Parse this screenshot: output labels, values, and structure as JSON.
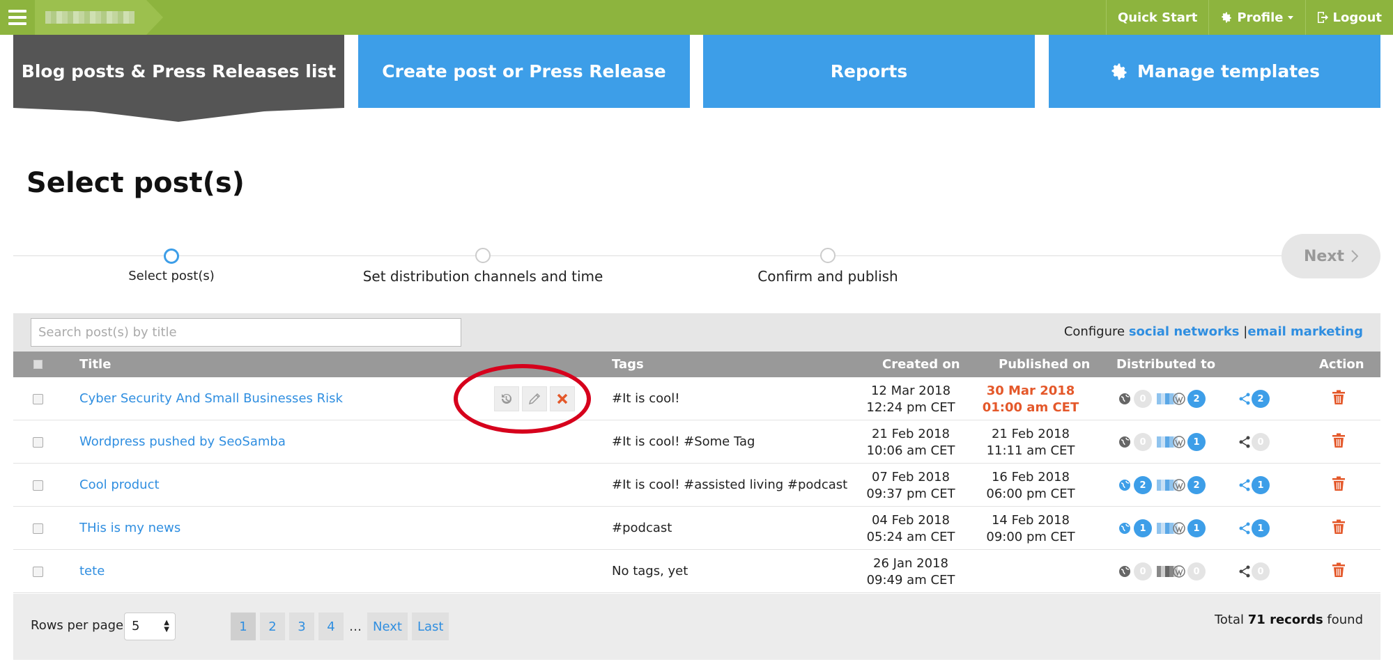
{
  "topbar": {
    "nav": {
      "quick_start": "Quick Start",
      "profile": "Profile",
      "logout": "Logout"
    }
  },
  "tabs": [
    {
      "label": "Blog posts & Press Releases list",
      "active": true
    },
    {
      "label": "Create post or Press Release",
      "active": false
    },
    {
      "label": "Reports",
      "active": false
    },
    {
      "label": "Manage templates",
      "active": false
    }
  ],
  "page_title": "Select post(s)",
  "stepper": {
    "steps": [
      "Select post(s)",
      "Set distribution channels and time",
      "Confirm and publish"
    ],
    "current": 0,
    "next_label": "Next"
  },
  "filter": {
    "search_placeholder": "Search post(s) by title",
    "configure_prefix": "Configure",
    "social_link": "social networks",
    "separator": "|",
    "email_link": "email marketing"
  },
  "table": {
    "headers": {
      "title": "Title",
      "tags": "Tags",
      "created": "Created on",
      "published": "Published on",
      "distributed": "Distributed to",
      "action": "Action"
    },
    "rows": [
      {
        "title": "Cyber Security And Small Businesses Risk",
        "tags": "#It is cool!",
        "created_date": "12 Mar 2018",
        "created_time": "12:24 pm CET",
        "published_date": "30 Mar 2018",
        "published_time": "01:00 am CET",
        "published_highlight": true,
        "web": "0",
        "wp": "2",
        "share": "2"
      },
      {
        "title": "Wordpress pushed by SeoSamba",
        "tags": "#It is cool! #Some Tag",
        "created_date": "21 Feb 2018",
        "created_time": "10:06 am CET",
        "published_date": "21 Feb 2018",
        "published_time": "11:11 am CET",
        "published_highlight": false,
        "web": "0",
        "wp": "1",
        "share": "0"
      },
      {
        "title": "Cool product",
        "tags": "#It is cool! #assisted living #podcast",
        "created_date": "07 Feb 2018",
        "created_time": "09:37 pm CET",
        "published_date": "16 Feb 2018",
        "published_time": "06:00 pm CET",
        "published_highlight": false,
        "web": "2",
        "wp": "2",
        "share": "1"
      },
      {
        "title": "THis is my news",
        "tags": "#podcast",
        "created_date": "04 Feb 2018",
        "created_time": "05:24 am CET",
        "published_date": "14 Feb 2018",
        "published_time": "09:00 pm CET",
        "published_highlight": false,
        "web": "1",
        "wp": "1",
        "share": "1"
      },
      {
        "title": "tete",
        "tags": "No tags, yet",
        "created_date": "26 Jan 2018",
        "created_time": "09:49 am CET",
        "published_date": "",
        "published_time": "",
        "published_highlight": false,
        "web": "0",
        "wp": "0",
        "share": "0"
      }
    ]
  },
  "footer": {
    "rows_label": "Rows per page:",
    "rows_value": "5",
    "pages": [
      "1",
      "2",
      "3",
      "4"
    ],
    "ellipsis": "…",
    "next": "Next",
    "last": "Last",
    "total_prefix": "Total",
    "total_count": "71 records",
    "total_suffix": "found"
  },
  "colors": {
    "topbar": "#8db43e",
    "tab_active": "#555555",
    "tab_blue": "#3d9ee8",
    "link": "#2f8ee0",
    "highlight": "#e4582a",
    "annotation": "#d6001c"
  },
  "icons": [
    "hamburger-icon",
    "gear-icon",
    "caret-down-icon",
    "logout-icon",
    "history-icon",
    "pencil-icon",
    "close-icon",
    "globe-icon",
    "wordpress-icon",
    "share-icon",
    "trash-icon",
    "chevron-right-icon"
  ]
}
